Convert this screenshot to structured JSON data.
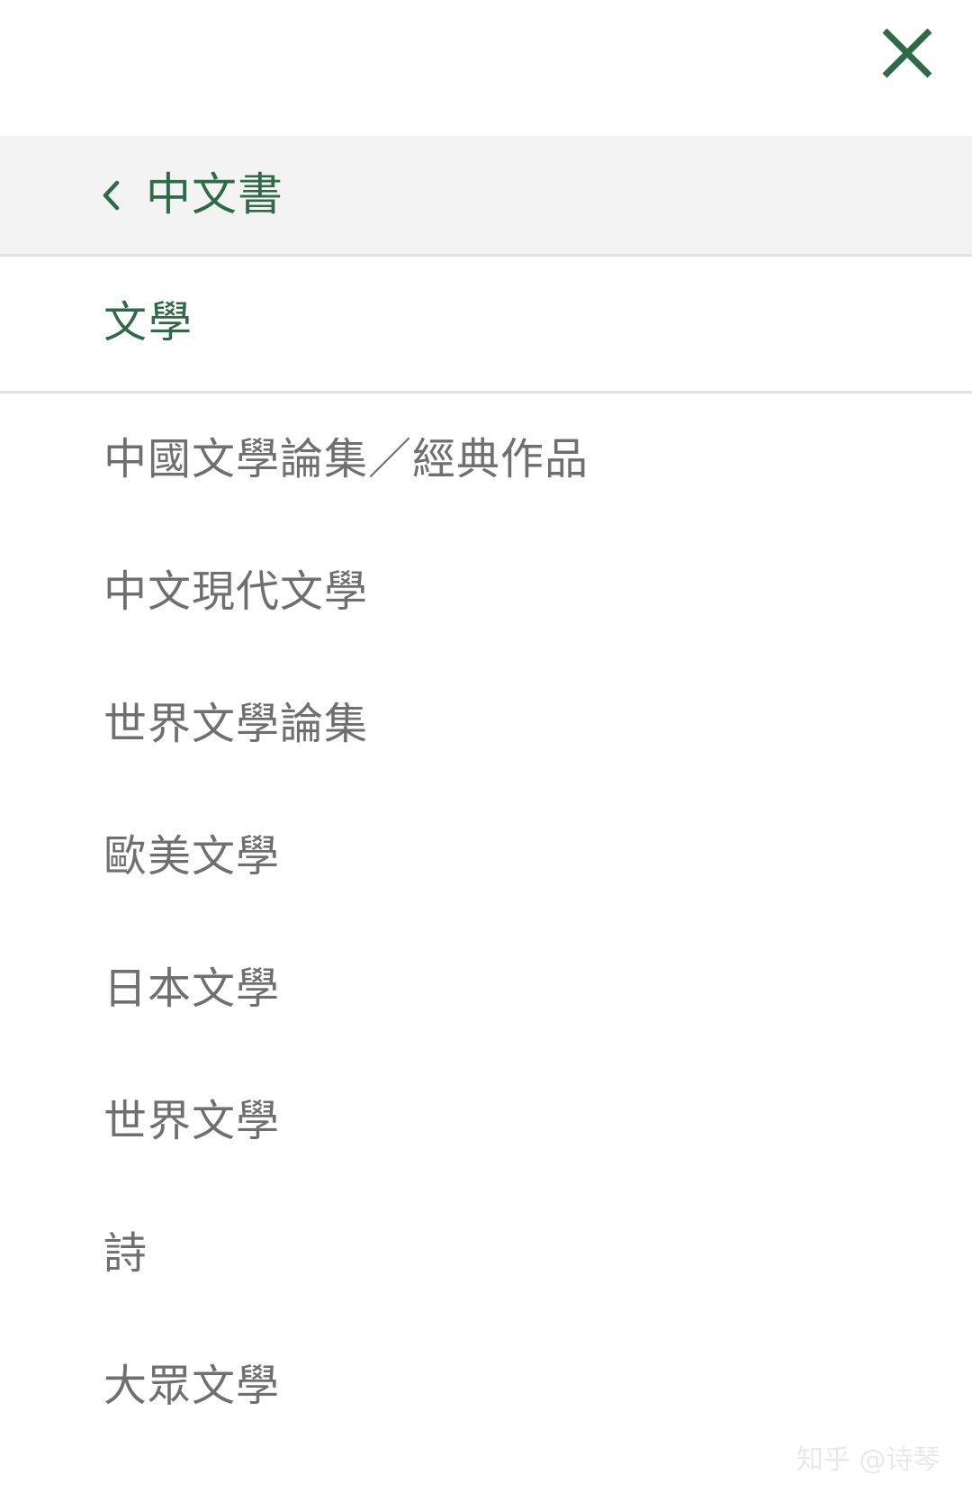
{
  "header": {
    "close_icon": "close-icon",
    "close_color": "#2f6a46"
  },
  "back_header": {
    "chevron_icon": "chevron-left-icon",
    "title": "中文書"
  },
  "current_category": {
    "label": "文學"
  },
  "subcategories": [
    {
      "label": "中國文學論集／經典作品"
    },
    {
      "label": "中文現代文學"
    },
    {
      "label": "世界文學論集"
    },
    {
      "label": "歐美文學"
    },
    {
      "label": "日本文學"
    },
    {
      "label": "世界文學"
    },
    {
      "label": "詩"
    },
    {
      "label": "大眾文學"
    }
  ],
  "watermark": {
    "text": "知乎 @诗琴"
  },
  "colors": {
    "accent_green": "#2f6a46",
    "item_gray": "#6f6f6f",
    "header_bg": "#f3f3f3",
    "divider": "#e1e1e1"
  }
}
